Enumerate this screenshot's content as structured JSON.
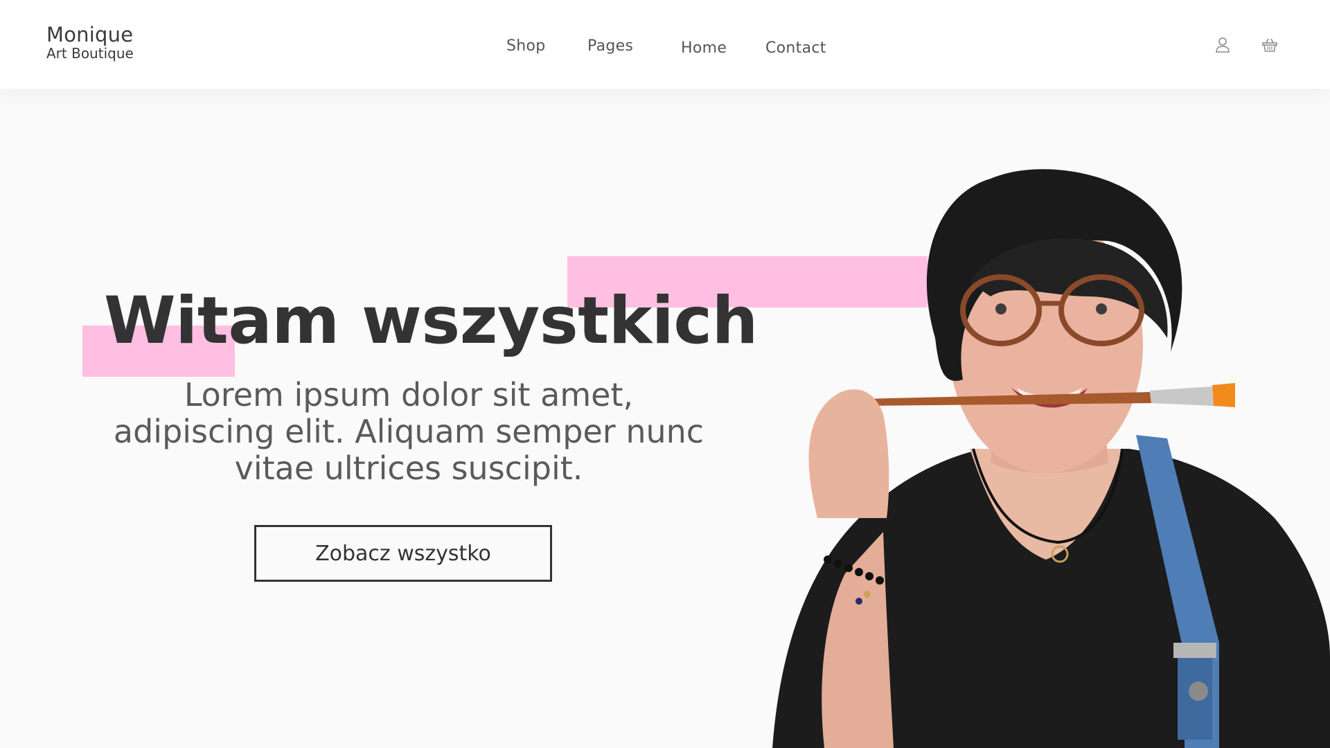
{
  "brand": {
    "name": "Monique",
    "subtitle": "Art Boutique"
  },
  "nav": {
    "items": [
      {
        "label": "Shop"
      },
      {
        "label": "Pages"
      },
      {
        "label": "Home"
      },
      {
        "label": "Contact"
      }
    ]
  },
  "header_icons": [
    "user-icon",
    "basket-icon"
  ],
  "hero": {
    "title": "Witam wszystkich",
    "text": "Lorem ipsum dolor sit amet, adipiscing elit. Aliquam semper nunc vitae ultrices suscipit.",
    "button_label": "Zobacz wszystko",
    "image": "portrait of smiling woman with glasses holding a paintbrush in her teeth"
  },
  "colors": {
    "accent": "#ffbfe2",
    "text_dark": "#333333",
    "text_muted": "#5a5a5a",
    "hero_background": "#fafafa"
  }
}
